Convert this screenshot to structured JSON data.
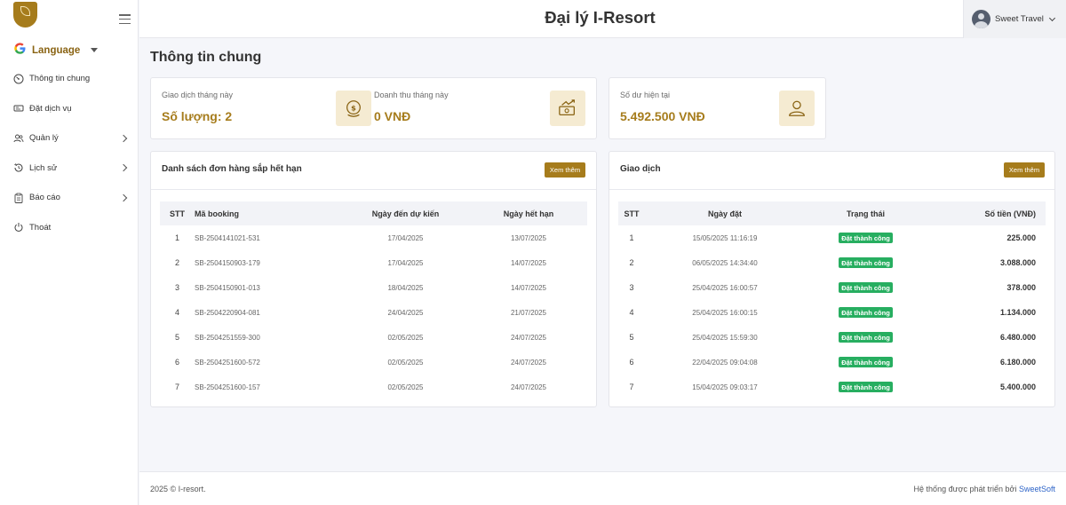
{
  "header": {
    "title": "Đại lý I-Resort",
    "user_name": "Sweet Travel"
  },
  "sidebar": {
    "language_label": "Language",
    "items": [
      {
        "label": "Thông tin chung",
        "icon": "dashboard-icon",
        "has_children": false
      },
      {
        "label": "Đặt dịch vụ",
        "icon": "ticket-icon",
        "has_children": false
      },
      {
        "label": "Quản lý",
        "icon": "users-icon",
        "has_children": true
      },
      {
        "label": "Lịch sử",
        "icon": "history-icon",
        "has_children": true
      },
      {
        "label": "Báo cáo",
        "icon": "clipboard-icon",
        "has_children": true
      },
      {
        "label": "Thoát",
        "icon": "power-icon",
        "has_children": false
      }
    ]
  },
  "page": {
    "title": "Thông tin chung"
  },
  "stats": {
    "transactions_label": "Giao dịch tháng này",
    "transactions_value": "Số lượng: 2",
    "revenue_label": "Doanh thu tháng này",
    "revenue_value": "0 VNĐ",
    "balance_label": "Số dư hiện tại",
    "balance_value": "5.492.500 VNĐ"
  },
  "expiring": {
    "title": "Danh sách đơn hàng sắp hết hạn",
    "more_label": "Xem thêm",
    "columns": [
      "STT",
      "Mã booking",
      "Ngày đến dự kiến",
      "Ngày hết hạn"
    ],
    "rows": [
      [
        "1",
        "SB-2504141021-531",
        "17/04/2025",
        "13/07/2025"
      ],
      [
        "2",
        "SB-2504150903-179",
        "17/04/2025",
        "14/07/2025"
      ],
      [
        "3",
        "SB-2504150901-013",
        "18/04/2025",
        "14/07/2025"
      ],
      [
        "4",
        "SB-2504220904-081",
        "24/04/2025",
        "21/07/2025"
      ],
      [
        "5",
        "SB-2504251559-300",
        "02/05/2025",
        "24/07/2025"
      ],
      [
        "6",
        "SB-2504251600-572",
        "02/05/2025",
        "24/07/2025"
      ],
      [
        "7",
        "SB-2504251600-157",
        "02/05/2025",
        "24/07/2025"
      ]
    ]
  },
  "transactions": {
    "title": "Giao dịch",
    "more_label": "Xem thêm",
    "columns": [
      "STT",
      "Ngày đặt",
      "Trạng thái",
      "Số tiền (VNĐ)"
    ],
    "rows": [
      [
        "1",
        "15/05/2025 11:16:19",
        "Đặt thành công",
        "225.000"
      ],
      [
        "2",
        "06/05/2025 14:34:40",
        "Đặt thành công",
        "3.088.000"
      ],
      [
        "3",
        "25/04/2025 16:00:57",
        "Đặt thành công",
        "378.000"
      ],
      [
        "4",
        "25/04/2025 16:00:15",
        "Đặt thành công",
        "1.134.000"
      ],
      [
        "5",
        "25/04/2025 15:59:30",
        "Đặt thành công",
        "6.480.000"
      ],
      [
        "6",
        "22/04/2025 09:04:08",
        "Đặt thành công",
        "6.180.000"
      ],
      [
        "7",
        "15/04/2025 09:03:17",
        "Đặt thành công",
        "5.400.000"
      ]
    ]
  },
  "footer": {
    "copyright": "2025 © I-resort.",
    "developed_by": "Hệ thống được phát triển bởi",
    "developer": "SweetSoft"
  },
  "colors": {
    "brand": "#a67c1c",
    "success": "#27ae60",
    "link": "#2e64c8"
  }
}
